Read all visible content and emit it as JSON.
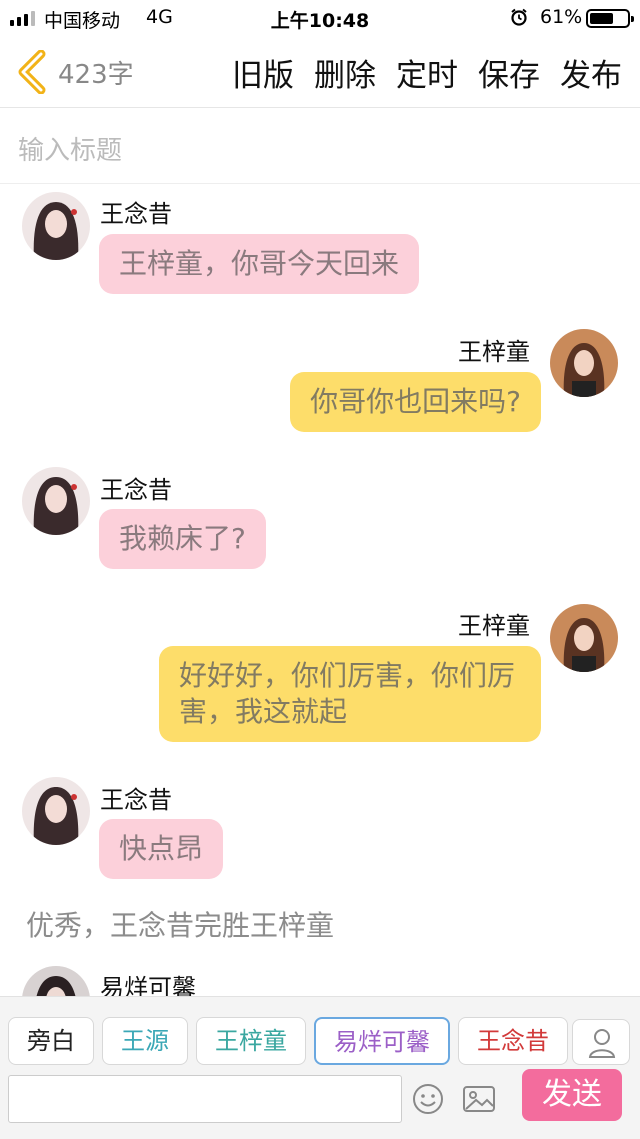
{
  "status_bar": {
    "carrier": "中国移动",
    "network": "4G",
    "time": "上午10:48",
    "battery_text": "61%",
    "battery_level": 0.61
  },
  "nav": {
    "word_count": "423字",
    "actions": [
      "旧版",
      "删除",
      "定时",
      "保存",
      "发布"
    ]
  },
  "title_input": {
    "placeholder": "输入标题"
  },
  "messages": [
    {
      "side": "left",
      "name": "王念昔",
      "text": "王梓童，你哥今天回来",
      "color": "#fcd0da"
    },
    {
      "side": "right",
      "name": "王梓童",
      "text": "你哥你也回来吗?",
      "color": "#fddd6a"
    },
    {
      "side": "left",
      "name": "王念昔",
      "text": "我赖床了?",
      "color": "#fcd0da"
    },
    {
      "side": "right",
      "name": "王梓童",
      "text": "好好好，你们厉害，你们厉害，我这就起",
      "color": "#fddd6a"
    },
    {
      "side": "left",
      "name": "王念昔",
      "text": "快点昂",
      "color": "#fcd0da"
    },
    {
      "side": "narration",
      "text": "优秀，王念昔完胜王梓童"
    },
    {
      "side": "left",
      "name": "易烊可馨",
      "text": ""
    }
  ],
  "bottom_bar": {
    "roles": [
      "旁白",
      "王源",
      "王梓童",
      "易烊可馨",
      "王念昔"
    ],
    "selected_role": "易烊可馨",
    "input_value": "",
    "send_label": "发送",
    "send_color": "#f36c9d"
  }
}
